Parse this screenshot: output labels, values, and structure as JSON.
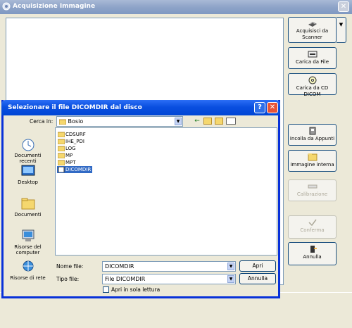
{
  "window": {
    "title": "Acquisizione Immagine",
    "close": "✕"
  },
  "buttons": {
    "scanner": "Acquisisci da Scanner",
    "file": "Carica da File",
    "cd": "Carica da CD DICOM",
    "clipboard": "Incolla da Appunti",
    "internal": "Immagine interna",
    "calibration": "Calibrazione",
    "confirm": "Conferma",
    "cancel": "Annulla",
    "scanner_dropdown": "▼"
  },
  "dialog": {
    "title": "Selezionare il file DICOMDIR dal disco",
    "help": "?",
    "close": "✕",
    "lookin_label": "Cerca in:",
    "lookin_value": "Bosio",
    "places": [
      "Documenti recenti",
      "Desktop",
      "Documenti",
      "Risorse del computer",
      "Risorse di rete"
    ],
    "files": [
      "CDSURF",
      "IHE_PDI",
      "LOG",
      "MP",
      "MPT",
      "DICOMDIR"
    ],
    "selected_file": "DICOMDIR",
    "filename_label": "Nome file:",
    "filename_value": "DICOMDIR",
    "filetype_label": "Tipo file:",
    "filetype_value": "File DICOMDIR",
    "open_button": "Apri",
    "cancel_button": "Annulla",
    "readonly_label": "Apri in sola lettura"
  },
  "colors": {
    "dialog_title": "#0a4fe0",
    "selection": "#316ac5",
    "folder": "#f5d76e"
  }
}
